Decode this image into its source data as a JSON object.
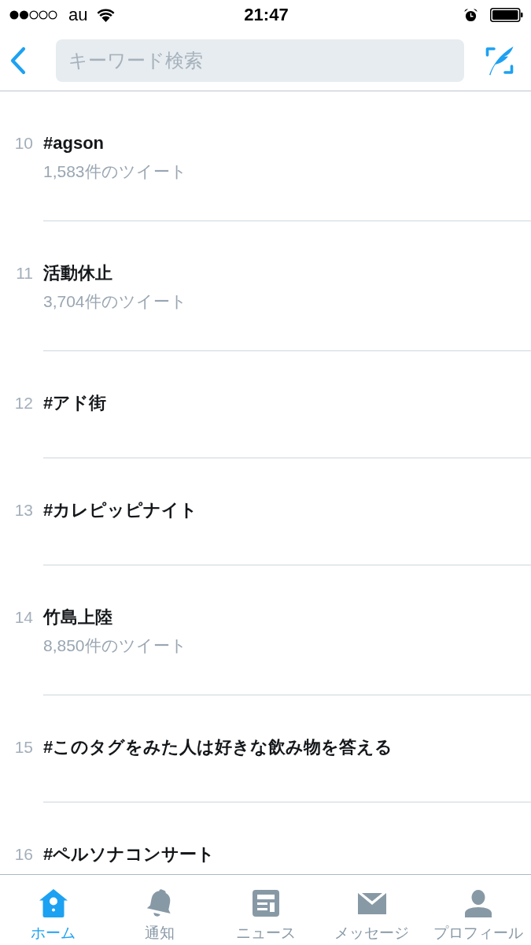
{
  "status_bar": {
    "carrier": "au",
    "time": "21:47"
  },
  "nav": {
    "search": {
      "placeholder": "キーワード検索"
    }
  },
  "trends": [
    {
      "rank": "10",
      "name": "#agson",
      "tweet_count": "1,583件のツイート"
    },
    {
      "rank": "11",
      "name": "活動休止",
      "tweet_count": "3,704件のツイート"
    },
    {
      "rank": "12",
      "name": "#アド街"
    },
    {
      "rank": "13",
      "name": "#カレピッピナイト"
    },
    {
      "rank": "14",
      "name": "竹島上陸",
      "tweet_count": "8,850件のツイート"
    },
    {
      "rank": "15",
      "name": "#このタグをみた人は好きな飲み物を答える"
    },
    {
      "rank": "16",
      "name": "#ペルソナコンサート"
    }
  ],
  "tab_bar": [
    {
      "label": "ホーム",
      "selected": true
    },
    {
      "label": "通知",
      "selected": false
    },
    {
      "label": "ニュース",
      "selected": false
    },
    {
      "label": "メッセージ",
      "selected": false
    },
    {
      "label": "プロフィール",
      "selected": false
    }
  ]
}
